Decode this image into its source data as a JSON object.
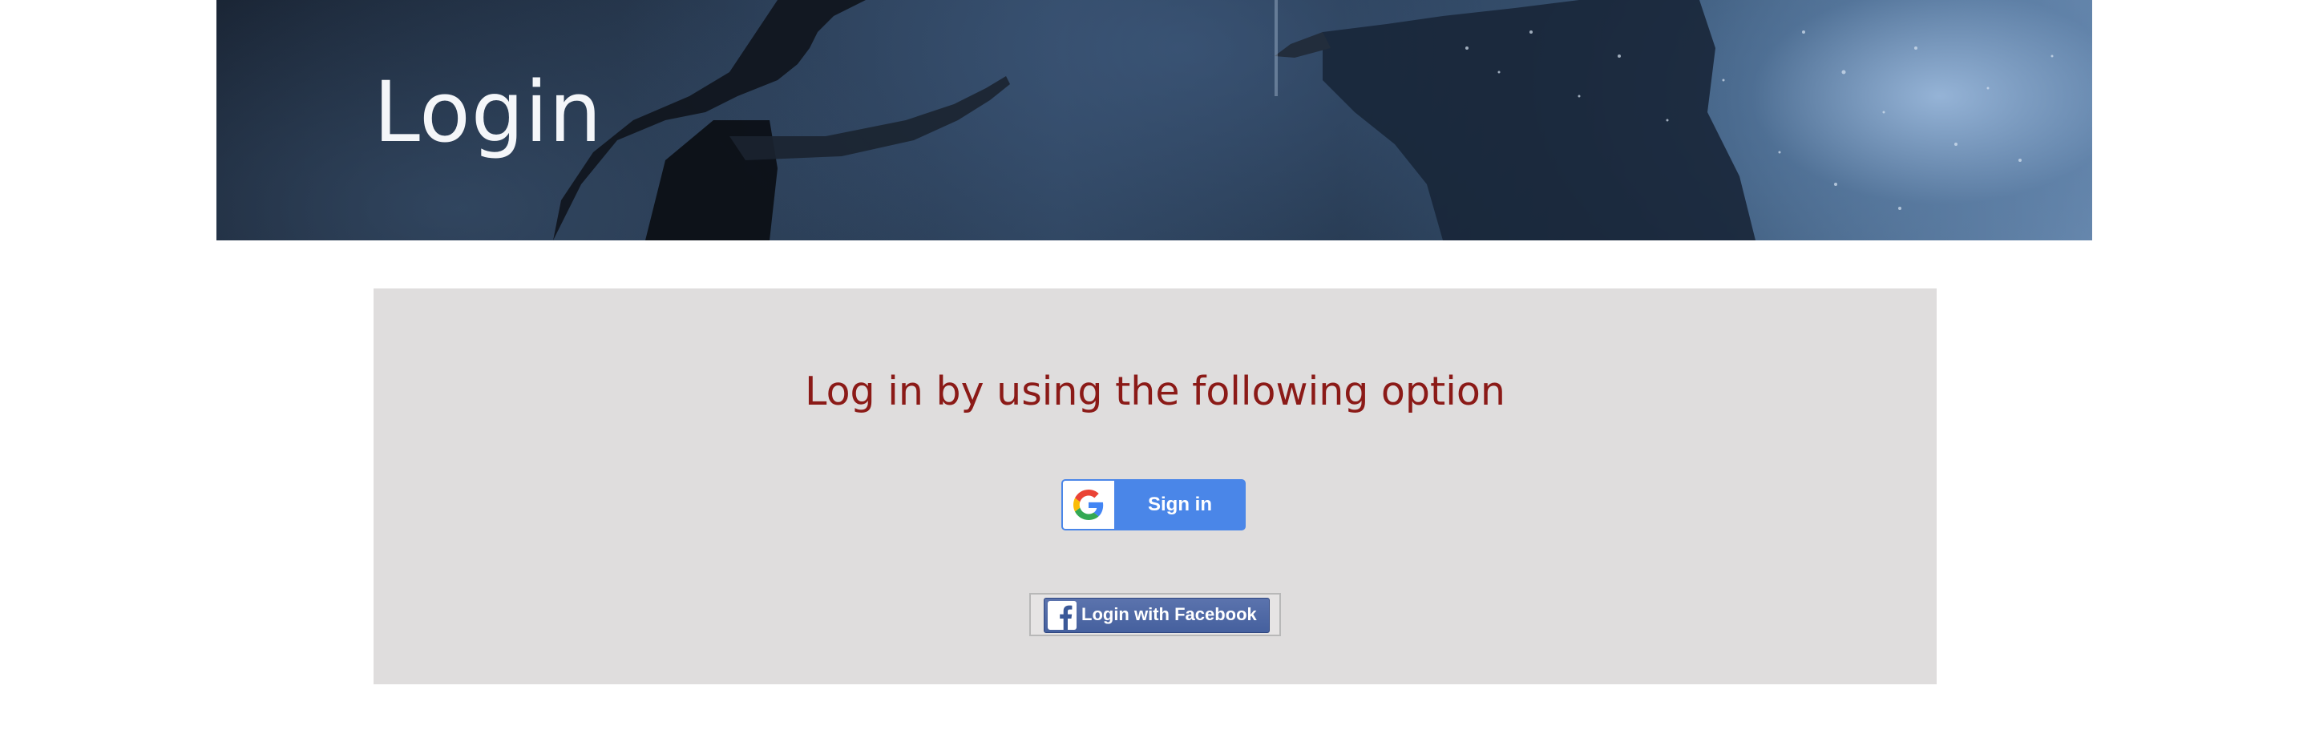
{
  "hero": {
    "title": "Login"
  },
  "login_panel": {
    "heading": "Log in by using the following option",
    "heading_color": "#8b1a17",
    "background_color": "#dfdddd"
  },
  "google_button": {
    "label": "Sign in",
    "icon": "google-g-logo",
    "color": "#4a86e8"
  },
  "facebook_button": {
    "label": "Login with Facebook",
    "icon": "facebook-f-logo",
    "color": "#4a63a3"
  }
}
